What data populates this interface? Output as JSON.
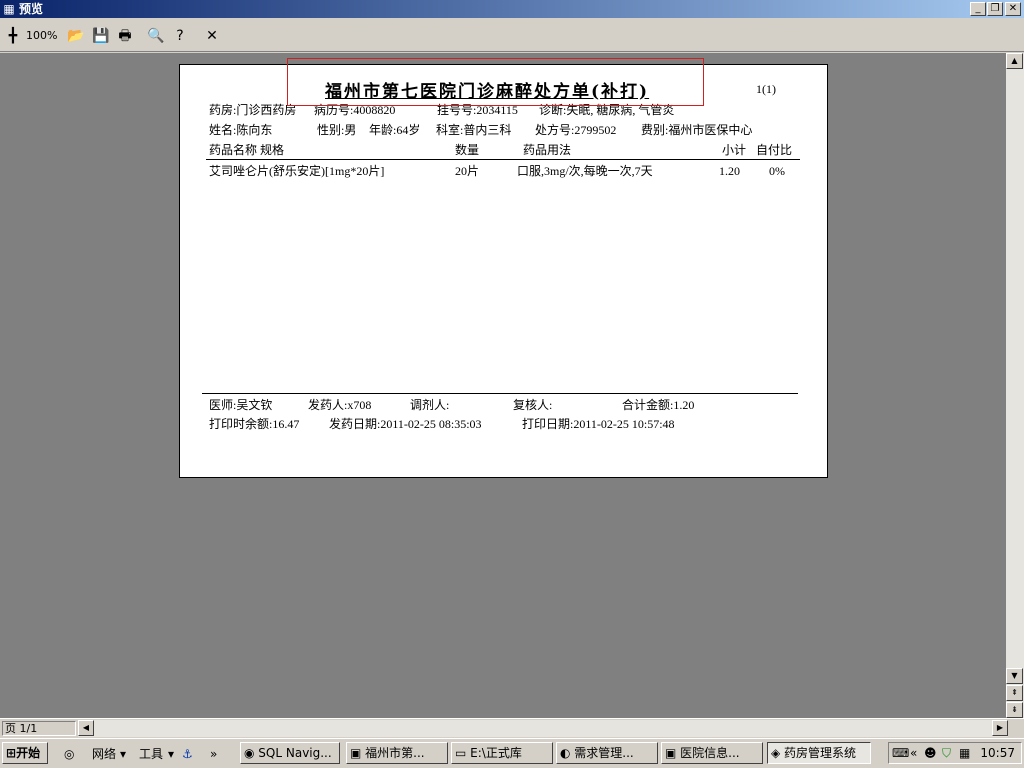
{
  "window": {
    "title": "预览",
    "minimize": "_",
    "restore": "❐",
    "close": "✕"
  },
  "toolbar": {
    "zoom": "100%"
  },
  "document": {
    "title": "福州市第七医院门诊麻醉处方单(补打)",
    "page_indicator": "1(1)",
    "pharmacy": "药房:门诊西药房",
    "record_no": "病历号:4008820",
    "register_no": "挂号号:2034115",
    "diagnosis": "诊断:失眠, 糖尿病, 气管炎",
    "name": "姓名:陈向东",
    "gender": "性别:男",
    "age": "年龄:64岁",
    "dept": "科室:普内三科",
    "rx_no": "处方号:2799502",
    "fee_type": "费别:福州市医保中心",
    "columns": {
      "drug": "药品名称 规格",
      "qty": "数量",
      "usage": "药品用法",
      "subtotal": "小计",
      "self_pay": "自付比"
    },
    "items": [
      {
        "drug": "艾司唑仑片(舒乐安定)[1mg*20片]",
        "qty": "20片",
        "usage": "口服,3mg/次,每晚一次,7天",
        "subtotal": "1.20",
        "self_pay": "0%"
      }
    ],
    "footer": {
      "doctor": "医师:吴文钦",
      "dispenser": "发药人:x708",
      "mixer": "调剂人:",
      "checker": "复核人:",
      "total": "合计金额:1.20",
      "balance": "打印时余额:16.47",
      "dispense_date": "发药日期:2011-02-25 08:35:03",
      "print_date": "打印日期:2011-02-25 10:57:48"
    }
  },
  "status": {
    "page": "页 1/1"
  },
  "taskbar": {
    "start": "开始",
    "quick": [
      "网络",
      "工具"
    ],
    "tasks": [
      {
        "label": "SQL Navig..."
      },
      {
        "label": "福州市第..."
      },
      {
        "label": "E:\\正式库"
      },
      {
        "label": "需求管理..."
      },
      {
        "label": "医院信息..."
      },
      {
        "label": "药房管理系统"
      }
    ],
    "clock": "10:57"
  }
}
